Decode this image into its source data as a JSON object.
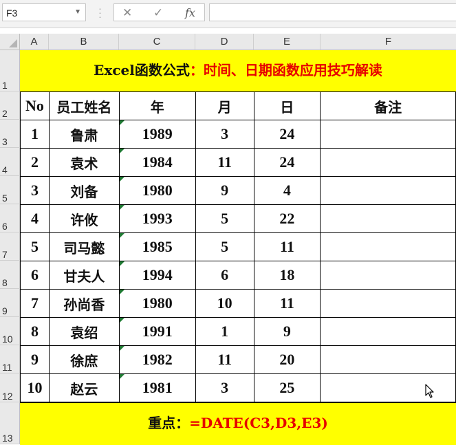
{
  "formula_bar": {
    "name_box": "F3",
    "formula": ""
  },
  "columns": [
    "A",
    "B",
    "C",
    "D",
    "E",
    "F"
  ],
  "rows": [
    "1",
    "2",
    "3",
    "4",
    "5",
    "6",
    "7",
    "8",
    "9",
    "10",
    "11",
    "12",
    "13"
  ],
  "title": {
    "part1": "Excel函数公式",
    "part2": "：时间、日期函数应用技巧解读"
  },
  "table": {
    "headers": [
      "No",
      "员工姓名",
      "年",
      "月",
      "日",
      "备注"
    ],
    "rows": [
      [
        "1",
        "鲁肃",
        "1989",
        "3",
        "24",
        ""
      ],
      [
        "2",
        "袁术",
        "1984",
        "11",
        "24",
        ""
      ],
      [
        "3",
        "刘备",
        "1980",
        "9",
        "4",
        ""
      ],
      [
        "4",
        "许攸",
        "1993",
        "5",
        "22",
        ""
      ],
      [
        "5",
        "司马懿",
        "1985",
        "5",
        "11",
        ""
      ],
      [
        "6",
        "甘夫人",
        "1994",
        "6",
        "18",
        ""
      ],
      [
        "7",
        "孙尚香",
        "1980",
        "10",
        "11",
        ""
      ],
      [
        "8",
        "袁绍",
        "1991",
        "1",
        "9",
        ""
      ],
      [
        "9",
        "徐庶",
        "1982",
        "11",
        "20",
        ""
      ],
      [
        "10",
        "赵云",
        "1981",
        "3",
        "25",
        ""
      ]
    ]
  },
  "footer": {
    "label": "重点：",
    "formula": "=DATE(C3,D3,E3)"
  },
  "colors": {
    "banner": "#ffff00",
    "accent_red": "#e60000",
    "error_triangle": "#1f7a33"
  },
  "icons": {
    "cancel": "close-icon",
    "enter": "check-icon",
    "insert_function": "fx-icon"
  }
}
